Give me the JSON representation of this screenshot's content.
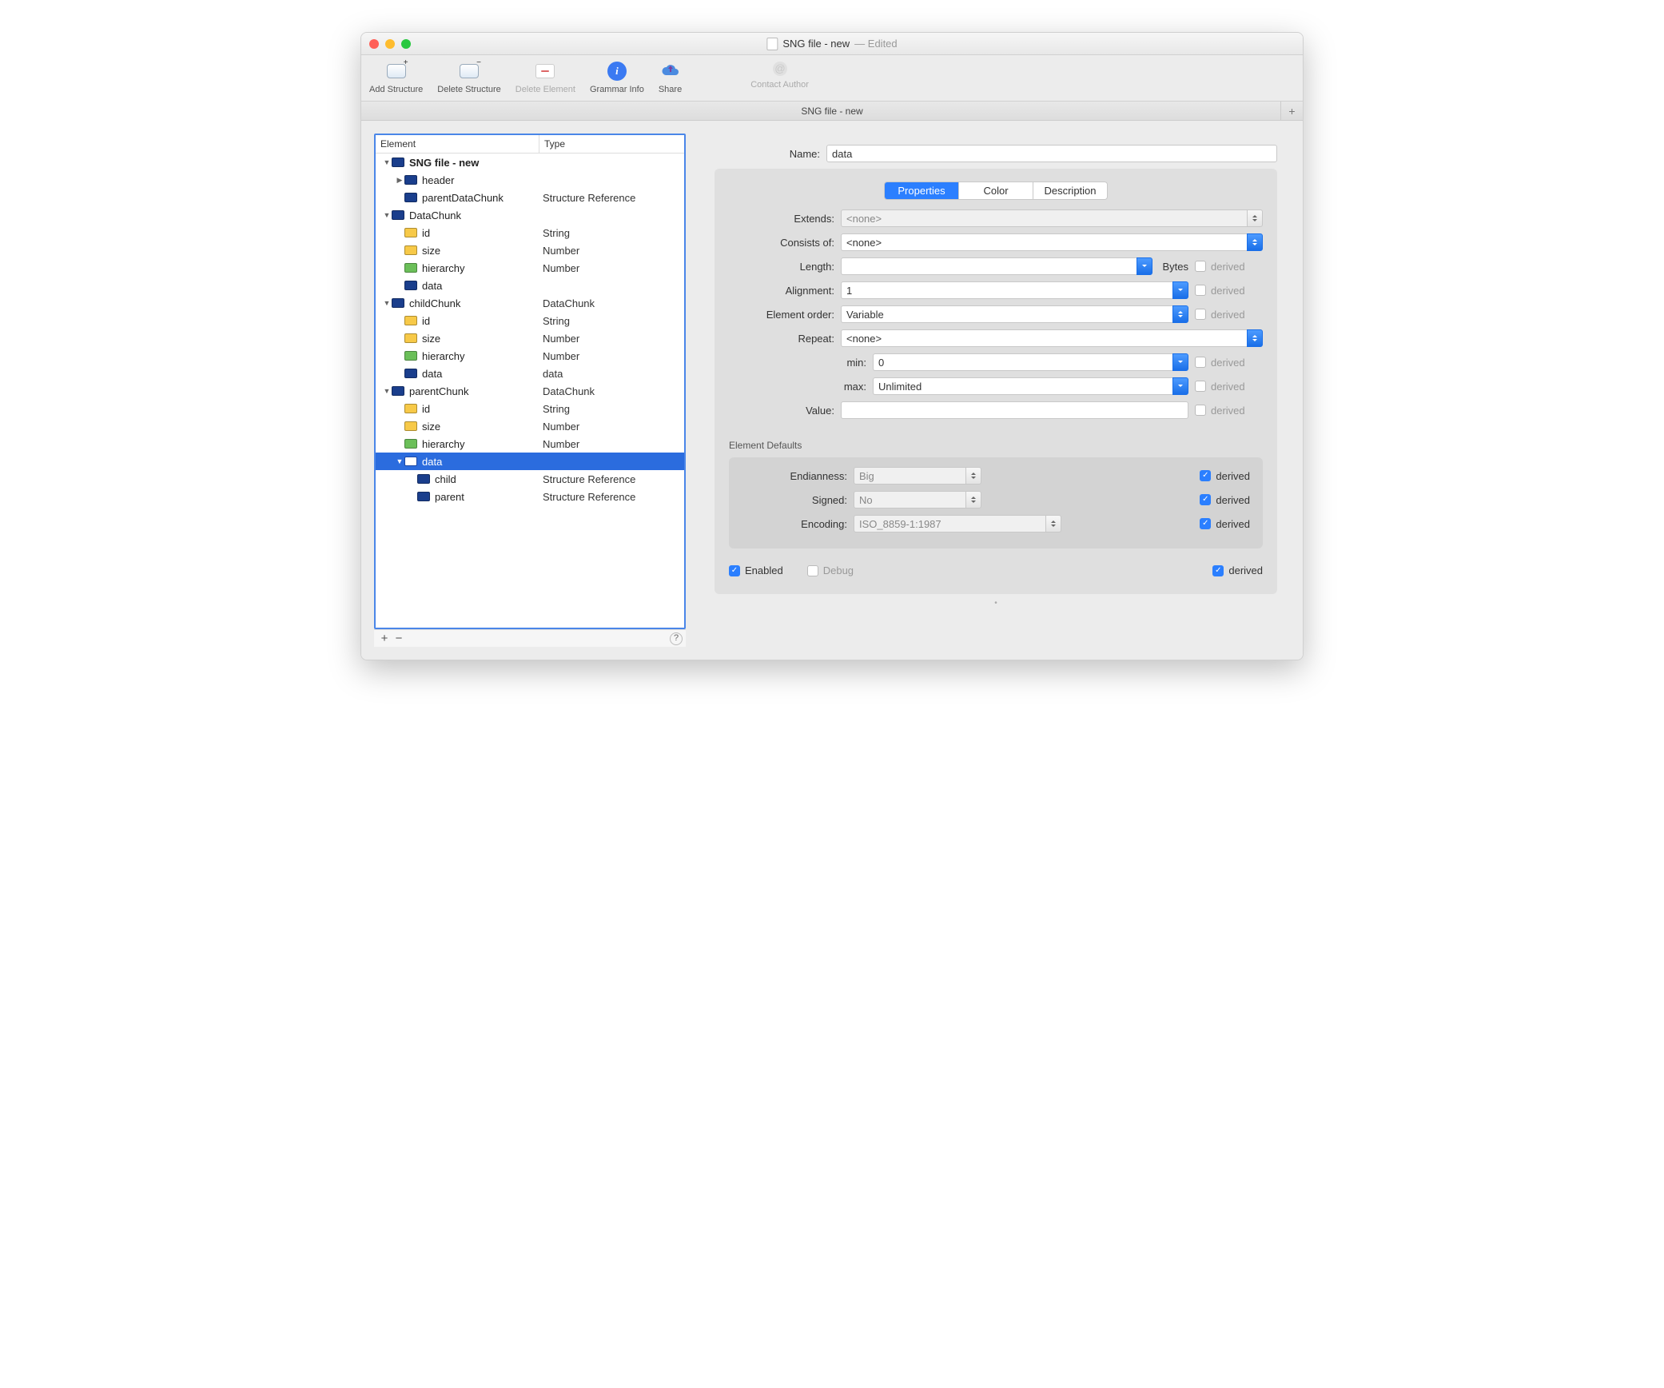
{
  "title": {
    "doc": "SNG file - new",
    "status": "— Edited"
  },
  "toolbar": {
    "addStructure": "Add Structure",
    "deleteStructure": "Delete Structure",
    "deleteElement": "Delete Element",
    "grammarInfo": "Grammar Info",
    "share": "Share",
    "contactAuthor": "Contact Author"
  },
  "tab": {
    "name": "SNG file - new"
  },
  "tree": {
    "headers": {
      "element": "Element",
      "type": "Type"
    },
    "rows": [
      {
        "indent": 0,
        "tri": "down",
        "icon": "db",
        "name": "SNG file - new",
        "bold": true,
        "type": ""
      },
      {
        "indent": 1,
        "tri": "right",
        "icon": "db",
        "name": "header",
        "type": ""
      },
      {
        "indent": 1,
        "tri": "",
        "icon": "db",
        "name": "parentDataChunk",
        "type": "Structure Reference"
      },
      {
        "indent": 0,
        "tri": "down",
        "icon": "db",
        "name": "DataChunk",
        "type": ""
      },
      {
        "indent": 1,
        "tri": "",
        "icon": "yl",
        "name": "id",
        "type": "String"
      },
      {
        "indent": 1,
        "tri": "",
        "icon": "yl",
        "name": "size",
        "type": "Number"
      },
      {
        "indent": 1,
        "tri": "",
        "icon": "gr",
        "name": "hierarchy",
        "type": "Number"
      },
      {
        "indent": 1,
        "tri": "",
        "icon": "db",
        "name": "data",
        "type": ""
      },
      {
        "indent": 0,
        "tri": "down",
        "icon": "db",
        "name": "childChunk",
        "type": "DataChunk"
      },
      {
        "indent": 1,
        "tri": "",
        "icon": "yl",
        "name": "id",
        "type": "String"
      },
      {
        "indent": 1,
        "tri": "",
        "icon": "yl",
        "name": "size",
        "type": "Number"
      },
      {
        "indent": 1,
        "tri": "",
        "icon": "gr",
        "name": "hierarchy",
        "type": "Number"
      },
      {
        "indent": 1,
        "tri": "",
        "icon": "db",
        "name": "data",
        "type": "data"
      },
      {
        "indent": 0,
        "tri": "down",
        "icon": "db",
        "name": "parentChunk",
        "type": "DataChunk"
      },
      {
        "indent": 1,
        "tri": "",
        "icon": "yl",
        "name": "id",
        "type": "String"
      },
      {
        "indent": 1,
        "tri": "",
        "icon": "yl",
        "name": "size",
        "type": "Number"
      },
      {
        "indent": 1,
        "tri": "",
        "icon": "gr",
        "name": "hierarchy",
        "type": "Number"
      },
      {
        "indent": 1,
        "tri": "down",
        "icon": "db",
        "name": "data",
        "type": "",
        "sel": true,
        "seli": "white"
      },
      {
        "indent": 2,
        "tri": "",
        "icon": "db",
        "name": "child",
        "type": "Structure Reference"
      },
      {
        "indent": 2,
        "tri": "",
        "icon": "db",
        "name": "parent",
        "type": "Structure Reference"
      }
    ]
  },
  "form": {
    "nameLab": "Name:",
    "nameVal": "data",
    "tabs": {
      "properties": "Properties",
      "color": "Color",
      "description": "Description"
    },
    "extendsLab": "Extends:",
    "extendsVal": "<none>",
    "consistsLab": "Consists of:",
    "consistsVal": "<none>",
    "lengthLab": "Length:",
    "lengthVal": "",
    "lengthUnit": "Bytes",
    "alignLab": "Alignment:",
    "alignVal": "1",
    "orderLab": "Element order:",
    "orderVal": "Variable",
    "repeatLab": "Repeat:",
    "repeatVal": "<none>",
    "minLab": "min:",
    "minVal": "0",
    "maxLab": "max:",
    "maxVal": "Unlimited",
    "valueLab": "Value:",
    "valueVal": "",
    "derived": "derived",
    "defaultsLab": "Element Defaults",
    "endianLab": "Endianness:",
    "endianVal": "Big",
    "signedLab": "Signed:",
    "signedVal": "No",
    "encodingLab": "Encoding:",
    "encodingVal": "ISO_8859-1:1987",
    "enabled": "Enabled",
    "debug": "Debug"
  }
}
